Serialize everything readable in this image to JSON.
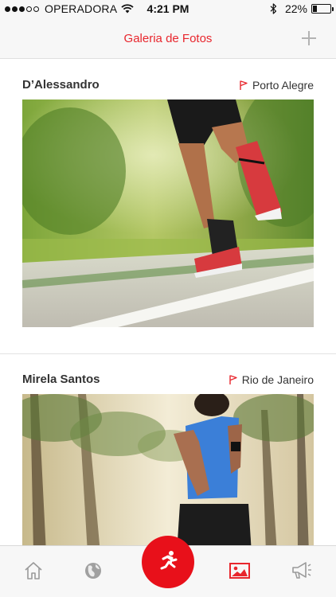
{
  "status_bar": {
    "carrier": "OPERADORA",
    "time": "4:21 PM",
    "battery": "22%",
    "battery_level": 0.22,
    "signal_bars_filled": 3,
    "signal_bars_total": 5
  },
  "nav": {
    "title": "Galeria de Fotos",
    "add_icon": "plus-icon"
  },
  "posts": [
    {
      "author": "D’Alessandro",
      "location": "Porto Alegre",
      "photo": "runner-shoes-on-road"
    },
    {
      "author": "Mirela Santos",
      "location": "Rio de Janeiro",
      "photo": "woman-running-palm-trees"
    }
  ],
  "tabs": [
    {
      "icon": "home-icon",
      "active": false
    },
    {
      "icon": "globe-icon",
      "active": false
    },
    {
      "icon": "runner-icon",
      "active": false
    },
    {
      "icon": "gallery-icon",
      "active": true
    },
    {
      "icon": "megaphone-icon",
      "active": false
    }
  ],
  "colors": {
    "accent": "#e8262d",
    "run_button": "#e8101a",
    "inactive_icon": "#9a9a9a",
    "bar_background": "#f7f7f7"
  }
}
